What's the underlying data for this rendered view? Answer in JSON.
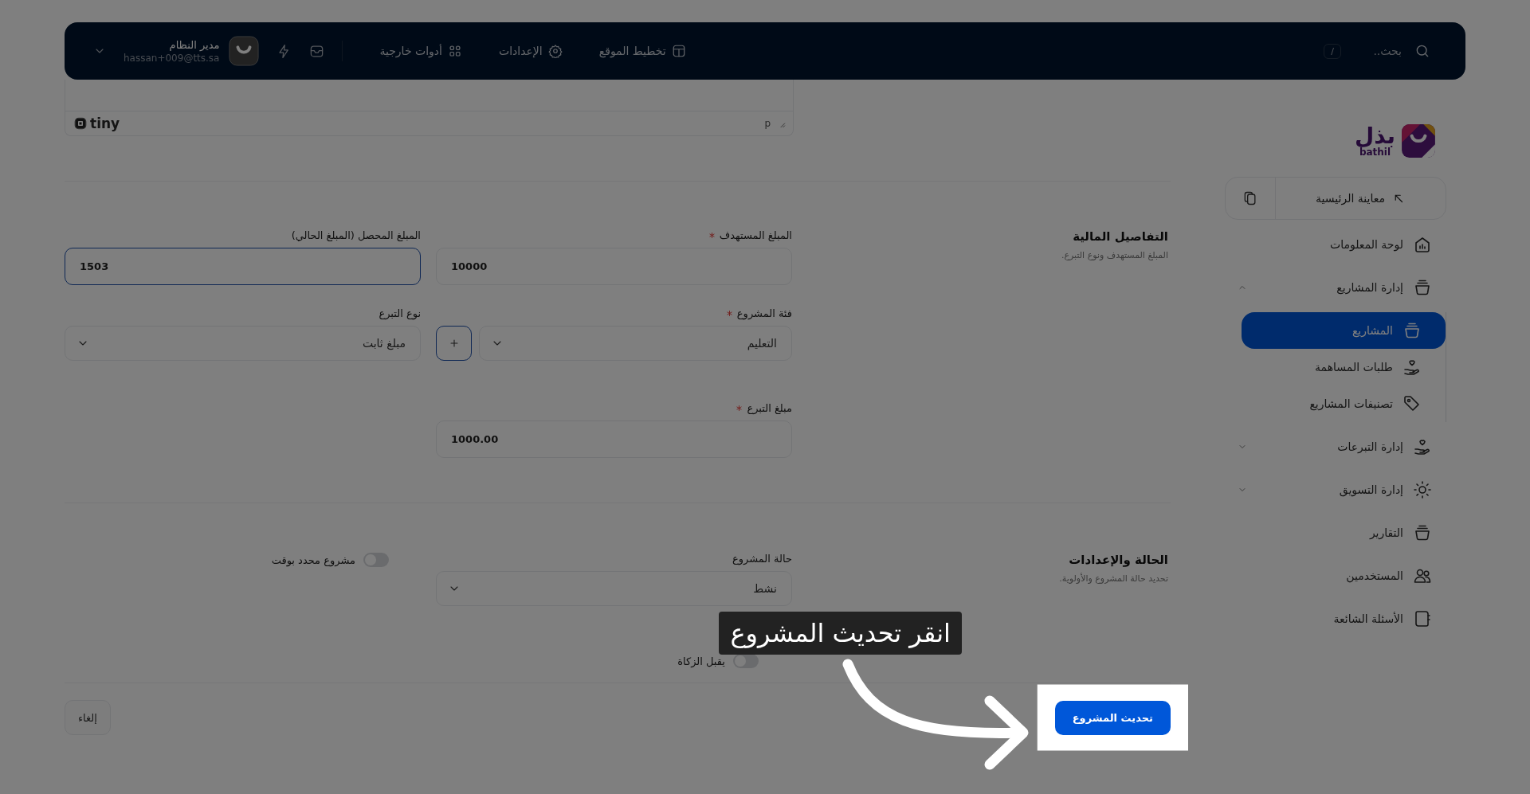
{
  "topbar": {
    "search": {
      "placeholder": "بحث..",
      "shortcut": "/"
    },
    "nav": [
      {
        "label": "تخطيط الموقع"
      },
      {
        "label": "الإعدادات"
      },
      {
        "label": "أدوات خارجية"
      }
    ],
    "user": {
      "name": "مدير النظام",
      "email": "hassan+009@tts.sa"
    }
  },
  "sidebar": {
    "logo": {
      "arabic": "بذل",
      "latin": "bathil"
    },
    "preview": {
      "label": "معاينة الرئيسية"
    },
    "items": [
      {
        "label": "لوحة المعلومات",
        "selected": false
      },
      {
        "label": "إدارة المشاريع",
        "selected": false,
        "expanded": true,
        "children": [
          {
            "label": "المشاريع",
            "selected": true
          },
          {
            "label": "طلبات المساهمة",
            "selected": false
          },
          {
            "label": "تصنيفات المشاريع",
            "selected": false
          }
        ]
      },
      {
        "label": "إدارة التبرعات",
        "selected": false,
        "expanded": false
      },
      {
        "label": "إدارة التسويق",
        "selected": false,
        "expanded": false
      },
      {
        "label": "التقارير",
        "selected": false
      },
      {
        "label": "المستخدمين",
        "selected": false
      },
      {
        "label": "الأسئلة الشائعة",
        "selected": false
      }
    ]
  },
  "editor": {
    "status_path": "p",
    "brand": "tiny"
  },
  "sections": [
    {
      "title": "التفاصيل المالية",
      "description": "المبلغ المستهدف ونوع التبرع.",
      "fields": [
        {
          "kind": "input",
          "label": "المبلغ المستهدف",
          "required": true,
          "value": "10000",
          "focused": false
        },
        {
          "kind": "input",
          "label": "المبلغ المحصل (المبلغ الحالي)",
          "required": false,
          "value": "1503",
          "focused": true
        },
        {
          "kind": "select_add",
          "label": "فئة المشروع",
          "required": true,
          "value": "التعليم"
        },
        {
          "kind": "select",
          "label": "نوع التبرع",
          "required": false,
          "value": "مبلغ ثابت"
        },
        {
          "kind": "input",
          "label": "مبلغ التبرع",
          "required": true,
          "value": "1000.00",
          "focused": false
        }
      ]
    },
    {
      "title": "الحالة والإعدادات",
      "description": "تحديد حالة المشروع والأولوية.",
      "fields": [
        {
          "kind": "select",
          "label": "حالة المشروع",
          "required": false,
          "value": "نشط"
        },
        {
          "kind": "toggle",
          "label": "مشروع محدد بوقت",
          "on": false
        },
        {
          "kind": "toggle",
          "label": "يقبل الزكاة",
          "on": false
        }
      ]
    }
  ],
  "actions": {
    "submit": "تحديث المشروع",
    "cancel": "إلغاء"
  },
  "tour": {
    "caption": "انقر تحديث المشروع"
  }
}
